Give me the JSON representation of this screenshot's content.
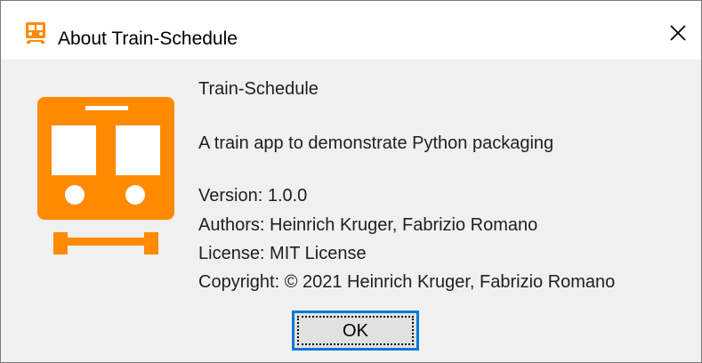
{
  "window": {
    "title": "About Train-Schedule",
    "app_icon": "train-icon",
    "close_icon": "close-icon"
  },
  "about": {
    "app_name": "Train-Schedule",
    "description": "A train app to demonstrate Python packaging",
    "version": "Version: 1.0.0",
    "authors": "Authors: Heinrich Kruger, Fabrizio Romano",
    "license": "License: MIT License",
    "copyright": "Copyright: © 2021 Heinrich Kruger, Fabrizio Romano"
  },
  "buttons": {
    "ok_label": "OK"
  },
  "colors": {
    "accent": "#0078d7",
    "brand": "#ff8a00",
    "text": "#1f1f1f",
    "background": "#f0f0f0"
  }
}
